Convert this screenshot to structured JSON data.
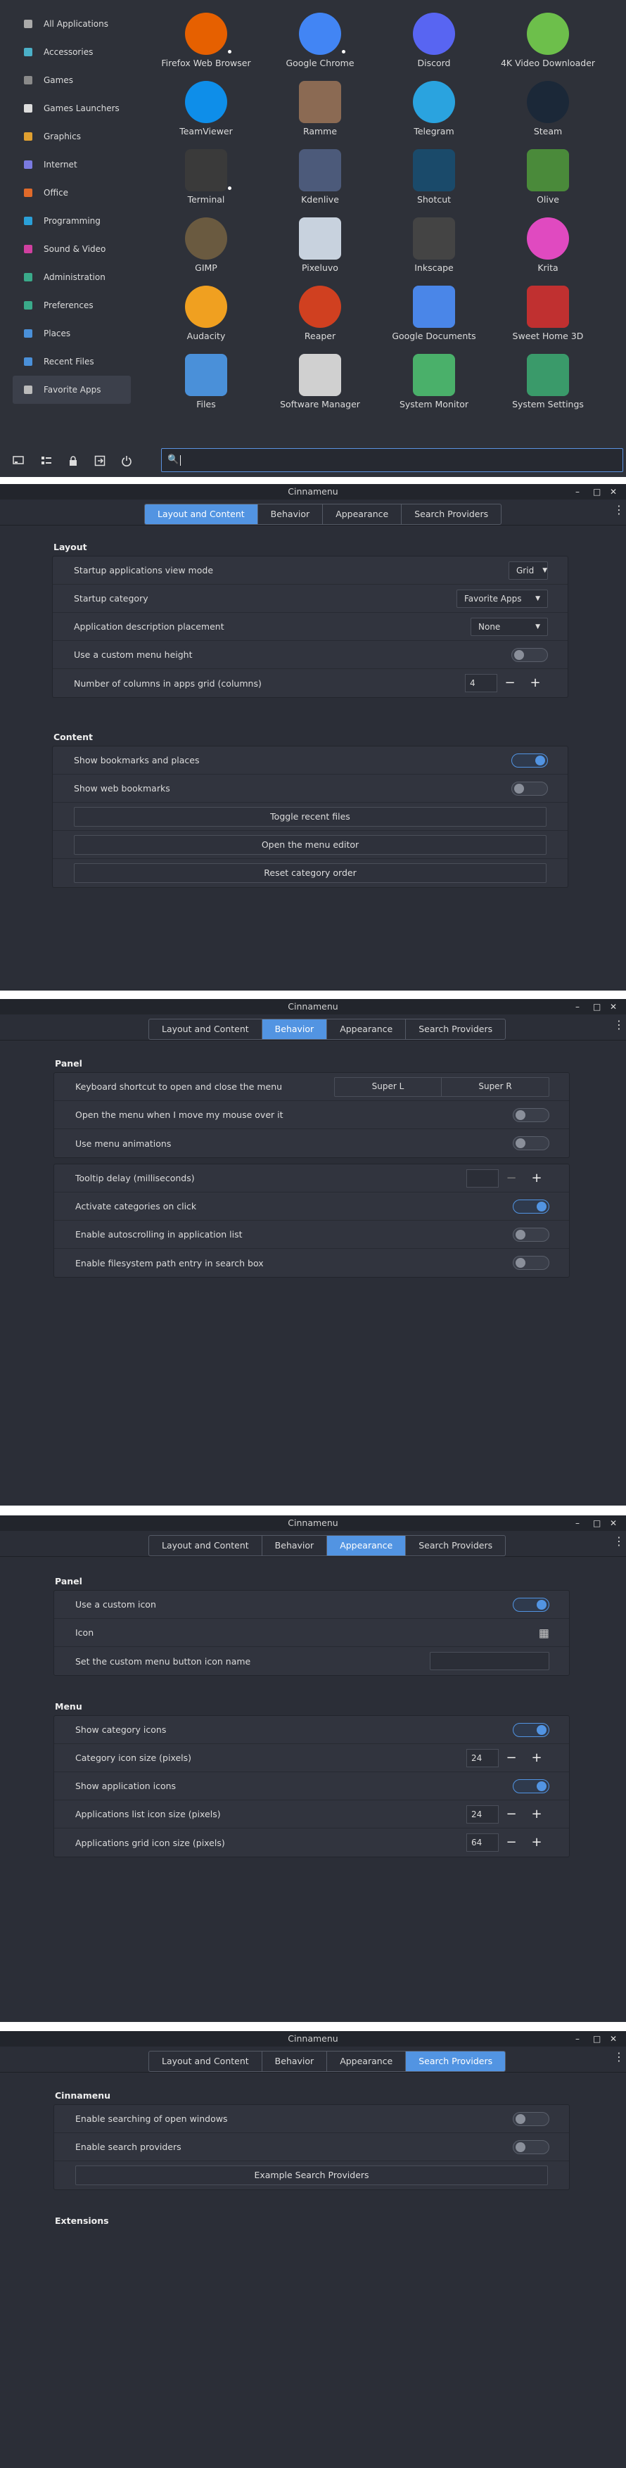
{
  "menu": {
    "categories": [
      {
        "label": "All Applications",
        "icon": "all-apps-icon"
      },
      {
        "label": "Accessories",
        "icon": "accessories-icon"
      },
      {
        "label": "Games",
        "icon": "games-icon"
      },
      {
        "label": "Games Launchers",
        "icon": "gamepad-icon"
      },
      {
        "label": "Graphics",
        "icon": "graphics-icon"
      },
      {
        "label": "Internet",
        "icon": "internet-icon"
      },
      {
        "label": "Office",
        "icon": "office-icon"
      },
      {
        "label": "Programming",
        "icon": "programming-icon"
      },
      {
        "label": "Sound & Video",
        "icon": "multimedia-icon"
      },
      {
        "label": "Administration",
        "icon": "administration-icon"
      },
      {
        "label": "Preferences",
        "icon": "preferences-icon"
      },
      {
        "label": "Places",
        "icon": "folder-icon"
      },
      {
        "label": "Recent Files",
        "icon": "recent-files-icon"
      },
      {
        "label": "Favorite Apps",
        "icon": "favorites-icon"
      }
    ],
    "selected_category": "Favorite Apps",
    "apps": [
      {
        "name": "Firefox Web Browser",
        "icon": "firefox-icon",
        "color": "#e66000",
        "running": true
      },
      {
        "name": "Google Chrome",
        "icon": "chrome-icon",
        "color": "#4285f4",
        "running": true
      },
      {
        "name": "Discord",
        "icon": "discord-icon",
        "color": "#5865f2",
        "running": false
      },
      {
        "name": "4K Video Downloader",
        "icon": "video-downloader-icon",
        "color": "#6dbf4b",
        "running": false
      },
      {
        "name": "TeamViewer",
        "icon": "teamviewer-icon",
        "color": "#0e8ee9",
        "running": false
      },
      {
        "name": "Ramme",
        "icon": "ramme-icon",
        "color": "#8b6a53",
        "running": false
      },
      {
        "name": "Telegram",
        "icon": "telegram-icon",
        "color": "#2aa3df",
        "running": false
      },
      {
        "name": "Steam",
        "icon": "steam-icon",
        "color": "#1b2838",
        "running": false
      },
      {
        "name": "Terminal",
        "icon": "terminal-icon",
        "color": "#3a3a3a",
        "running": true
      },
      {
        "name": "Kdenlive",
        "icon": "kdenlive-icon",
        "color": "#4c5a7a",
        "running": false
      },
      {
        "name": "Shotcut",
        "icon": "shotcut-icon",
        "color": "#1a4a6a",
        "running": false
      },
      {
        "name": "Olive",
        "icon": "olive-icon",
        "color": "#4a8a3a",
        "running": false
      },
      {
        "name": "GIMP",
        "icon": "gimp-icon",
        "color": "#6a5a40",
        "running": false
      },
      {
        "name": "Pixeluvo",
        "icon": "pixeluvo-icon",
        "color": "#c8d2de",
        "running": false
      },
      {
        "name": "Inkscape",
        "icon": "inkscape-icon",
        "color": "#444",
        "running": false
      },
      {
        "name": "Krita",
        "icon": "krita-icon",
        "color": "#e04ac0",
        "running": false
      },
      {
        "name": "Audacity",
        "icon": "audacity-icon",
        "color": "#f0a020",
        "running": false
      },
      {
        "name": "Reaper",
        "icon": "reaper-icon",
        "color": "#d04020",
        "running": false
      },
      {
        "name": "Google Documents",
        "icon": "google-docs-icon",
        "color": "#4a86e8",
        "running": false
      },
      {
        "name": "Sweet Home 3D",
        "icon": "sweet-home-icon",
        "color": "#c03030",
        "running": false
      },
      {
        "name": "Files",
        "icon": "files-folder-icon",
        "color": "#4a90d9",
        "running": false
      },
      {
        "name": "Software Manager",
        "icon": "software-manager-icon",
        "color": "#d0d0d0",
        "running": false
      },
      {
        "name": "System Monitor",
        "icon": "system-monitor-icon",
        "color": "#4ab06a",
        "running": false
      },
      {
        "name": "System Settings",
        "icon": "system-settings-icon",
        "color": "#3a9a6a",
        "running": false
      }
    ],
    "bottom_icons": [
      "screen-icon",
      "applets-icon",
      "lock-icon",
      "logout-icon",
      "power-icon"
    ],
    "search_icon": "magnifier-icon"
  },
  "window": {
    "title": "Cinnamenu",
    "tabs": [
      "Layout and Content",
      "Behavior",
      "Appearance",
      "Search Providers"
    ]
  },
  "layout": {
    "section_layout": "Layout",
    "view_mode_label": "Startup applications view mode",
    "view_mode_value": "Grid",
    "startup_category_label": "Startup category",
    "startup_category_value": "Favorite Apps",
    "desc_placement_label": "Application description placement",
    "desc_placement_value": "None",
    "custom_height_label": "Use a custom menu height",
    "columns_label": "Number of columns in apps grid (columns)",
    "columns_value": "4",
    "section_content": "Content",
    "bookmarks_label": "Show bookmarks and places",
    "web_bookmarks_label": "Show web bookmarks",
    "toggle_recent": "Toggle recent files",
    "open_editor": "Open the menu editor",
    "reset_order": "Reset category order"
  },
  "behavior": {
    "section_panel": "Panel",
    "shortcut_label": "Keyboard shortcut to open and close the menu",
    "shortcut_1": "Super L",
    "shortcut_2": "Super R",
    "hover_label": "Open the menu when I move my mouse over it",
    "animations_label": "Use menu animations",
    "tooltip_label": "Tooltip delay (milliseconds)",
    "tooltip_value": "",
    "activate_label": "Activate categories on click",
    "autoscroll_label": "Enable autoscrolling in application list",
    "filesystem_label": "Enable filesystem path entry in search box"
  },
  "appearance": {
    "section_panel": "Panel",
    "custom_icon_label": "Use a custom icon",
    "icon_label": "Icon",
    "icon_name_label": "Set the custom menu button icon name",
    "section_menu": "Menu",
    "show_cat_icons_label": "Show category icons",
    "cat_icon_size_label": "Category icon size (pixels)",
    "cat_icon_size_value": "24",
    "show_app_icons_label": "Show application icons",
    "list_icon_size_label": "Applications list icon size (pixels)",
    "list_icon_size_value": "24",
    "grid_icon_size_label": "Applications grid icon size (pixels)",
    "grid_icon_size_value": "64"
  },
  "search": {
    "section_cinnamenu": "Cinnamenu",
    "open_windows_label": "Enable searching of open windows",
    "providers_label": "Enable search providers",
    "example_button": "Example Search Providers",
    "section_extensions": "Extensions"
  },
  "glyphs": {
    "minimize": "–",
    "maximize": "□",
    "close": "✕",
    "caret": "▼",
    "minus": "−",
    "plus": "+",
    "kebab": "⋮",
    "grid": "▦",
    "search": "🔍"
  }
}
